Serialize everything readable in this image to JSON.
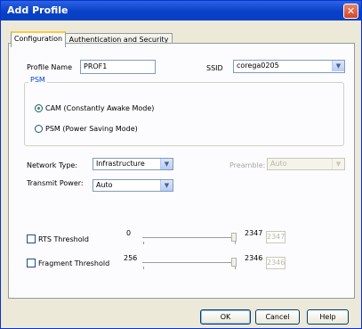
{
  "window": {
    "title": "Add Profile",
    "close_glyph": "✕"
  },
  "tabs": [
    {
      "label": "Configuration"
    },
    {
      "label": "Authentication and Security"
    }
  ],
  "profile": {
    "name_label": "Profile Name",
    "name_value": "PROF1"
  },
  "ssid": {
    "label": "SSID",
    "value": "corega0205"
  },
  "psm": {
    "group_label": "PSM",
    "options": [
      {
        "label": "CAM (Constantly Awake Mode)",
        "selected": true
      },
      {
        "label": "PSM (Power Saving Mode)",
        "selected": false
      }
    ]
  },
  "network_type": {
    "label": "Network Type:",
    "value": "Infrastructure"
  },
  "preamble": {
    "label": "Preamble:",
    "value": "Auto"
  },
  "transmit_power": {
    "label": "Transmit Power:",
    "value": "Auto"
  },
  "rts": {
    "label": "RTS Threshold",
    "min": "0",
    "max": "2347",
    "value": "2347",
    "checked": false
  },
  "fragment": {
    "label": "Fragment Threshold",
    "min": "256",
    "max": "2346",
    "value": "2346",
    "checked": false
  },
  "buttons": {
    "ok": "OK",
    "cancel": "Cancel",
    "help": "Help"
  },
  "icons": {
    "arrow": "▼"
  }
}
